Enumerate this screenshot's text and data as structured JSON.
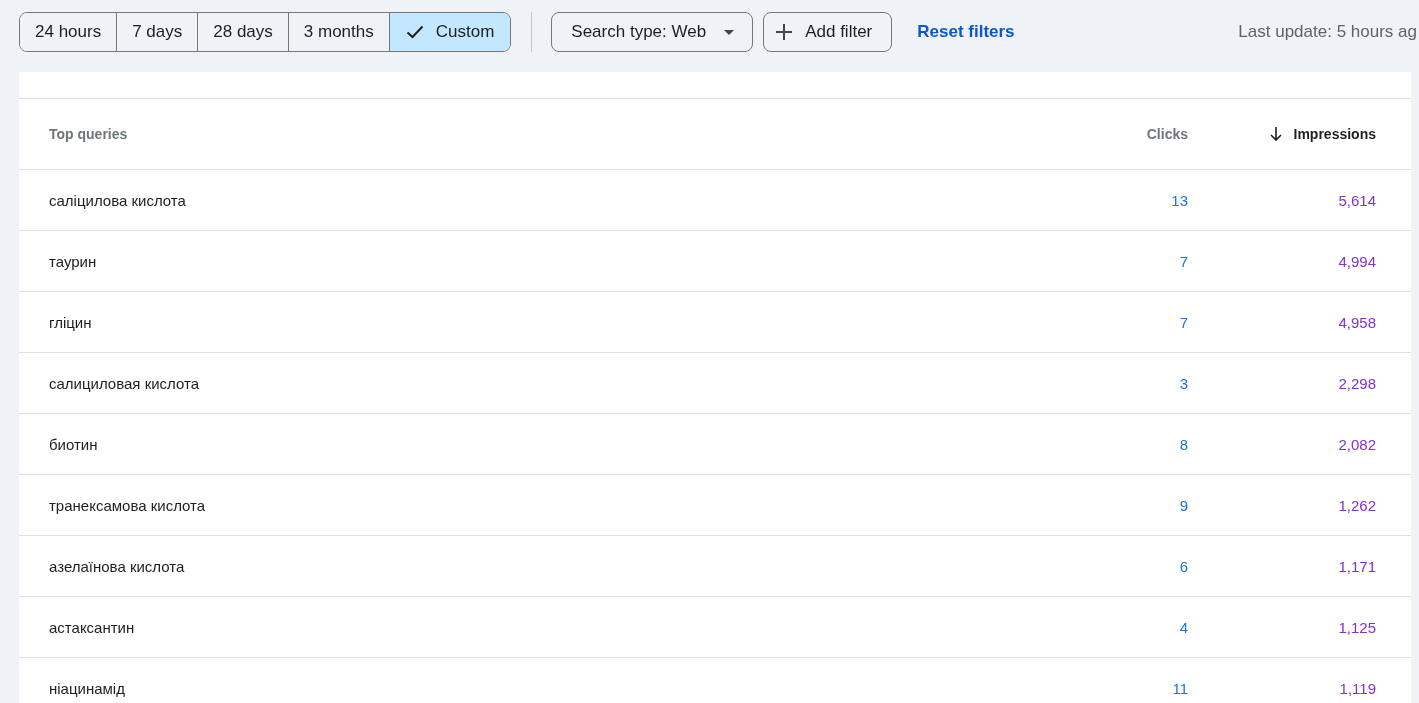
{
  "date_ranges": [
    {
      "label": "24 hours",
      "selected": false
    },
    {
      "label": "7 days",
      "selected": false
    },
    {
      "label": "28 days",
      "selected": false
    },
    {
      "label": "3 months",
      "selected": false
    },
    {
      "label": "Custom",
      "selected": true
    }
  ],
  "search_type": "Search type: Web",
  "add_filter": "Add filter",
  "reset_filters": "Reset filters",
  "last_update": "Last update: 5 hours ag",
  "table": {
    "columns": [
      {
        "label": "Top queries",
        "sorted": false
      },
      {
        "label": "Clicks",
        "sorted": false
      },
      {
        "label": "Impressions",
        "sorted": true
      }
    ],
    "rows": [
      {
        "query": "саліцилова кислота",
        "clicks": "13",
        "impressions": "5,614"
      },
      {
        "query": "таурин",
        "clicks": "7",
        "impressions": "4,994"
      },
      {
        "query": "гліцин",
        "clicks": "7",
        "impressions": "4,958"
      },
      {
        "query": "салициловая кислота",
        "clicks": "3",
        "impressions": "2,298"
      },
      {
        "query": "биотин",
        "clicks": "8",
        "impressions": "2,082"
      },
      {
        "query": "транексамова кислота",
        "clicks": "9",
        "impressions": "1,262"
      },
      {
        "query": "азелаїнова кислота",
        "clicks": "6",
        "impressions": "1,171"
      },
      {
        "query": "астаксантин",
        "clicks": "4",
        "impressions": "1,125"
      },
      {
        "query": "ніацинамід",
        "clicks": "11",
        "impressions": "1,119"
      }
    ]
  }
}
